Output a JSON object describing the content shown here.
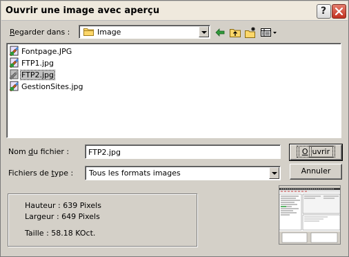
{
  "window": {
    "title": "Ouvrir une image avec aperçu",
    "help_glyph": "?",
    "close_icon": "close-icon"
  },
  "lookin": {
    "label_pre": "",
    "label_u": "R",
    "label_post": "egarder dans :",
    "value": "Image",
    "folder_icon": "folder-icon"
  },
  "toolbar": {
    "icons": [
      "back-arrow-icon",
      "up-folder-icon",
      "new-folder-icon",
      "view-menu-icon"
    ]
  },
  "files": [
    {
      "name": "Fontpage.JPG",
      "selected": false
    },
    {
      "name": "FTP1.jpg",
      "selected": false
    },
    {
      "name": "FTP2.jpg",
      "selected": true
    },
    {
      "name": "GestionSites.jpg",
      "selected": false
    }
  ],
  "filename": {
    "label_pre": "Nom ",
    "label_u": "d",
    "label_post": "u fichier :",
    "value": "FTP2.jpg"
  },
  "filetype": {
    "label_pre": "Fichiers de ",
    "label_u": "t",
    "label_post": "ype :",
    "value": "Tous les formats images"
  },
  "buttons": {
    "open_u": "O",
    "open_rest": "uvrir",
    "cancel": "Annuler"
  },
  "info": {
    "height": "Hauteur : 639 Pixels",
    "width": "Largeur : 649 Pixels",
    "size": "Taille : 58.18 KOct."
  }
}
